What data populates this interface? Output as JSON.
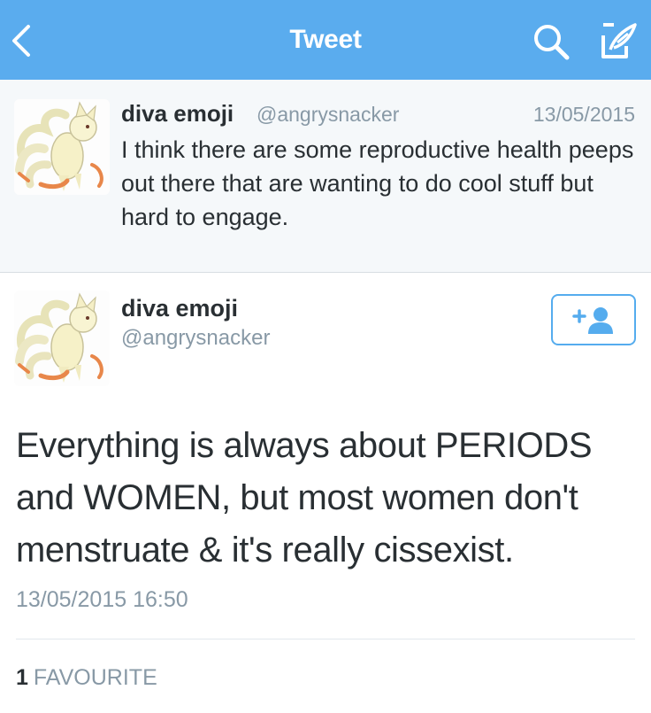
{
  "header": {
    "title": "Tweet",
    "back_icon": "chevron-left-icon",
    "search_icon": "search-icon",
    "compose_icon": "compose-tweet-icon",
    "background_color": "#5aacee"
  },
  "reply_tweet": {
    "name": "diva emoji",
    "handle": "@angrysnacker",
    "date": "13/05/2015",
    "text": "I think there are some reproductive health peeps out there that are wanting to do cool stuff but hard to engage."
  },
  "main_tweet": {
    "name": "diva emoji",
    "handle": "@angrysnacker",
    "follow_icon": "add-user-icon",
    "text": "Everything is always about PERIODS and WOMEN, but most women don't menstruate & it's really cissexist.",
    "timestamp": "13/05/2015 16:50",
    "favourites_count": "1",
    "favourites_label": "FAVOURITE"
  },
  "colors": {
    "accent": "#55acee",
    "secondary_text": "#8899a6",
    "primary_text": "#292f33"
  }
}
